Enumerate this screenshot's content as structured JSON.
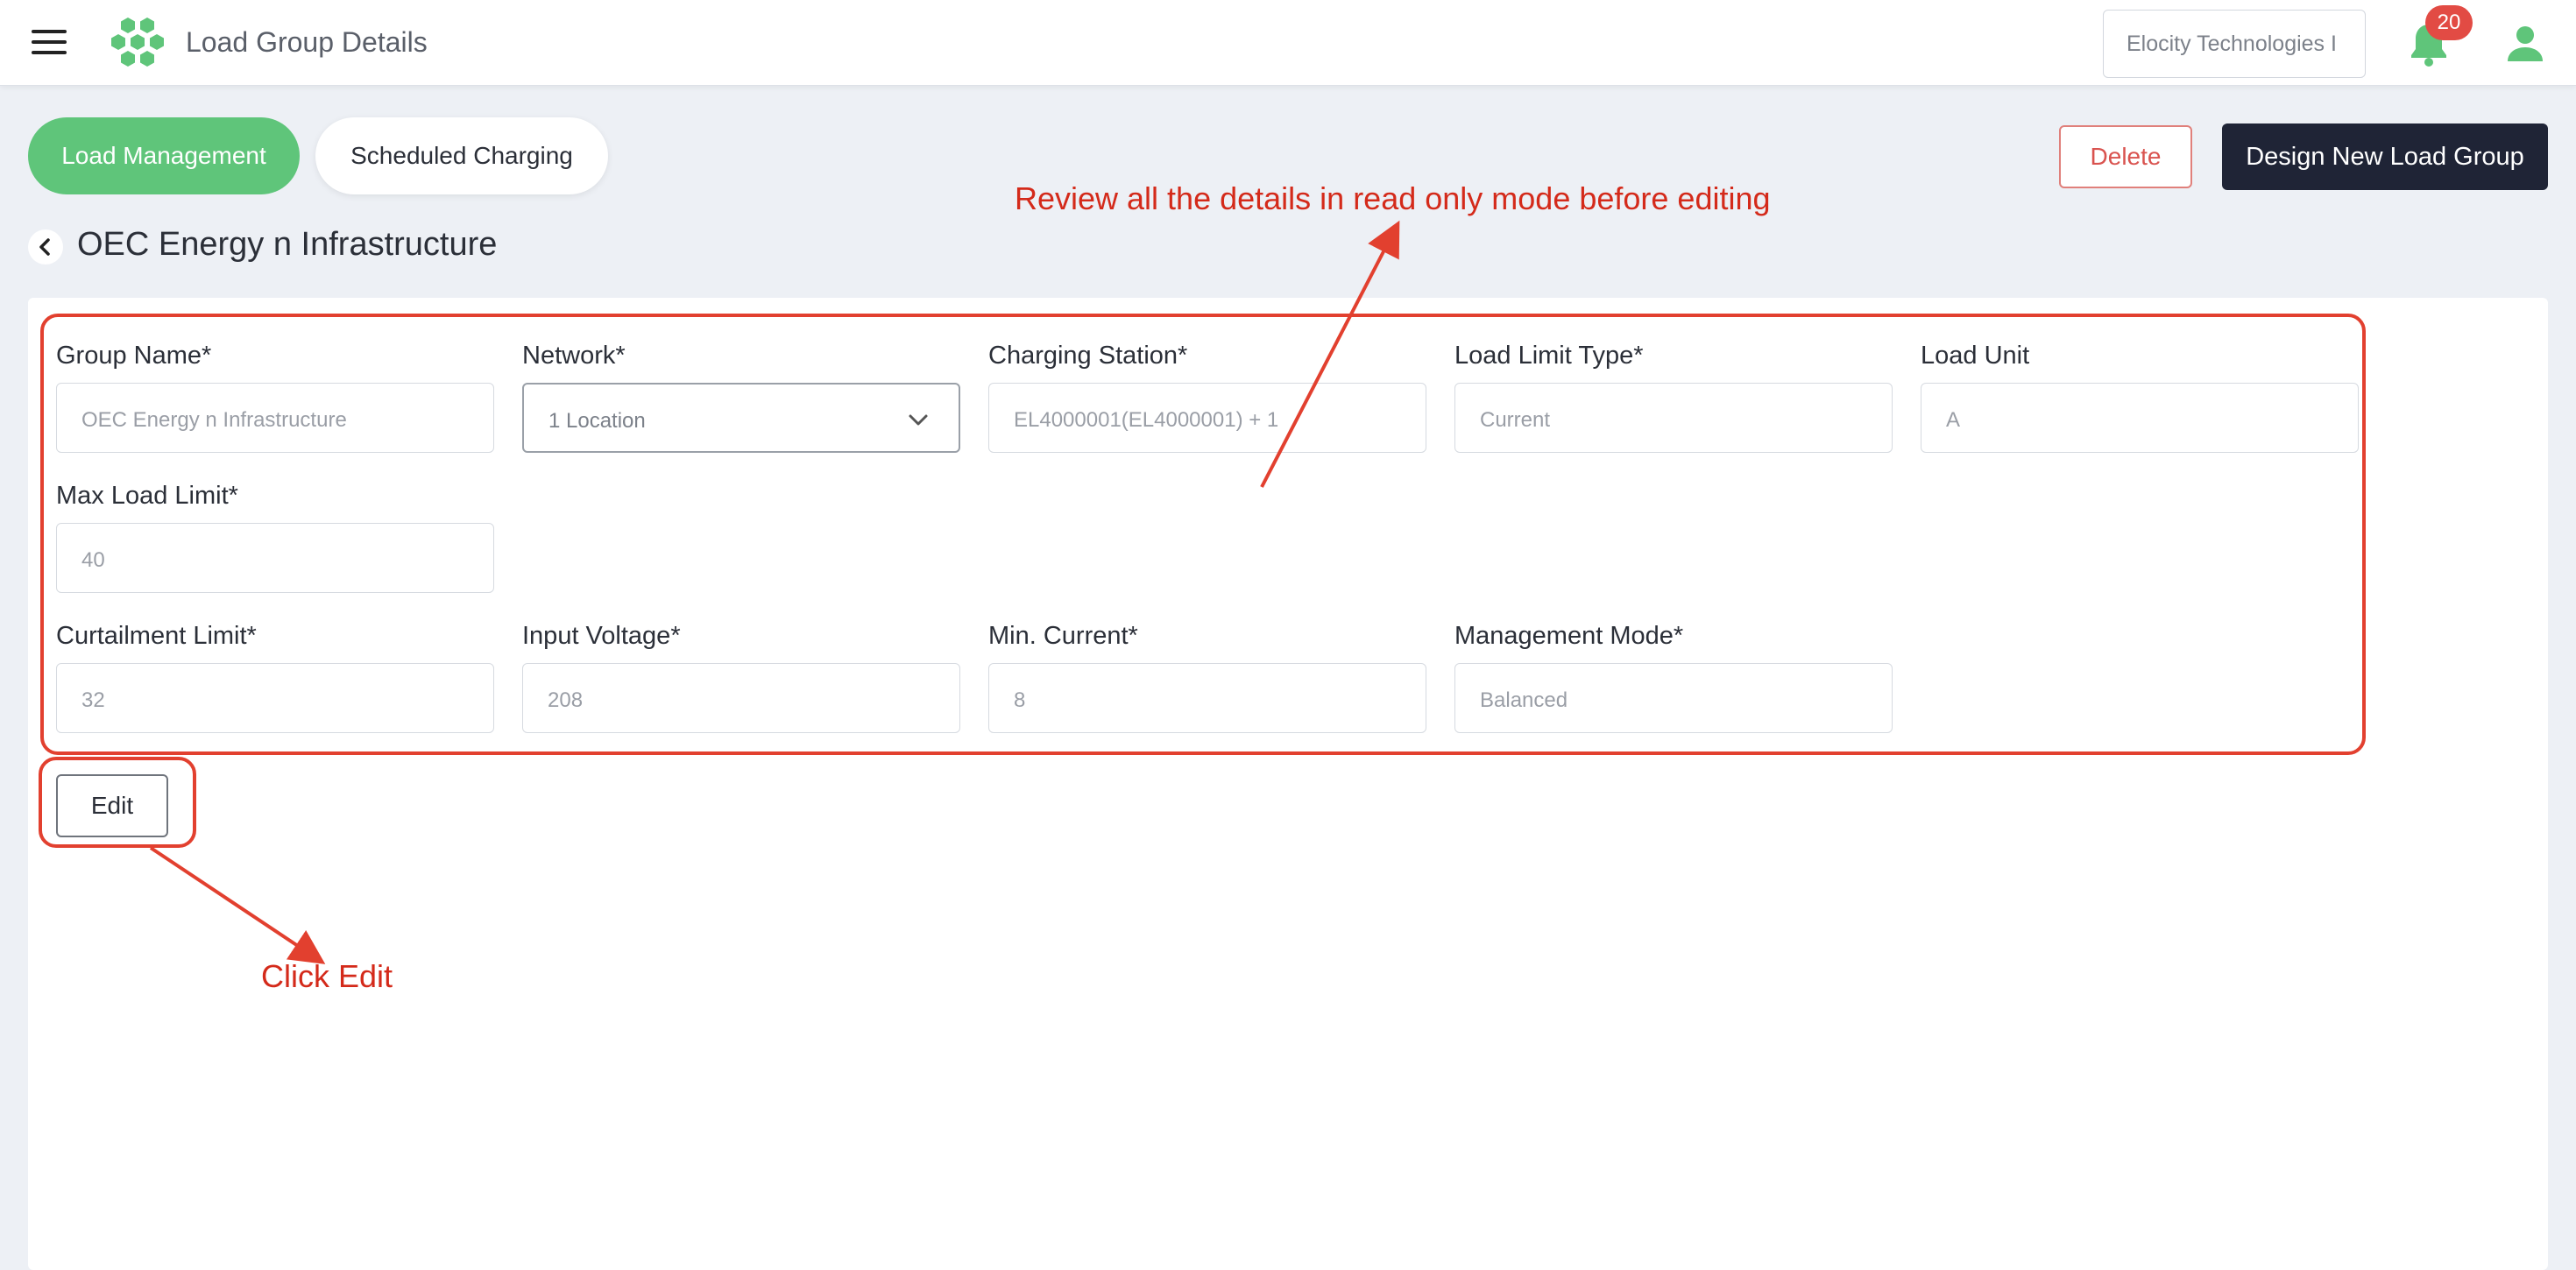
{
  "header": {
    "app_title": "Load Group Details",
    "company": "Elocity Technologies I",
    "notification_count": "20",
    "brand_color": "#5fc57a"
  },
  "tabs": [
    {
      "label": "Load Management",
      "active": true
    },
    {
      "label": "Scheduled Charging",
      "active": false
    }
  ],
  "actions": {
    "delete_label": "Delete",
    "design_label": "Design New Load Group"
  },
  "page": {
    "title": "OEC Energy n Infrastructure"
  },
  "form": {
    "group_name": {
      "label": "Group Name*",
      "value": "OEC Energy n Infrastructure"
    },
    "network": {
      "label": "Network*",
      "value": "1 Location"
    },
    "charging_station": {
      "label": "Charging Station*",
      "value": "EL4000001(EL4000001) + 1"
    },
    "load_limit_type": {
      "label": "Load Limit Type*",
      "value": "Current"
    },
    "load_unit": {
      "label": "Load Unit",
      "value": "A"
    },
    "max_load_limit": {
      "label": "Max Load Limit*",
      "value": "40"
    },
    "curtailment_limit": {
      "label": "Curtailment Limit*",
      "value": "32"
    },
    "input_voltage": {
      "label": "Input Voltage*",
      "value": "208"
    },
    "min_current": {
      "label": "Min. Current*",
      "value": "8"
    },
    "management_mode": {
      "label": "Management Mode*",
      "value": "Balanced"
    },
    "edit_label": "Edit"
  },
  "annotations": {
    "review_note": "Review all the details in read only mode before editing",
    "click_note": "Click Edit",
    "color": "#e2402f"
  }
}
